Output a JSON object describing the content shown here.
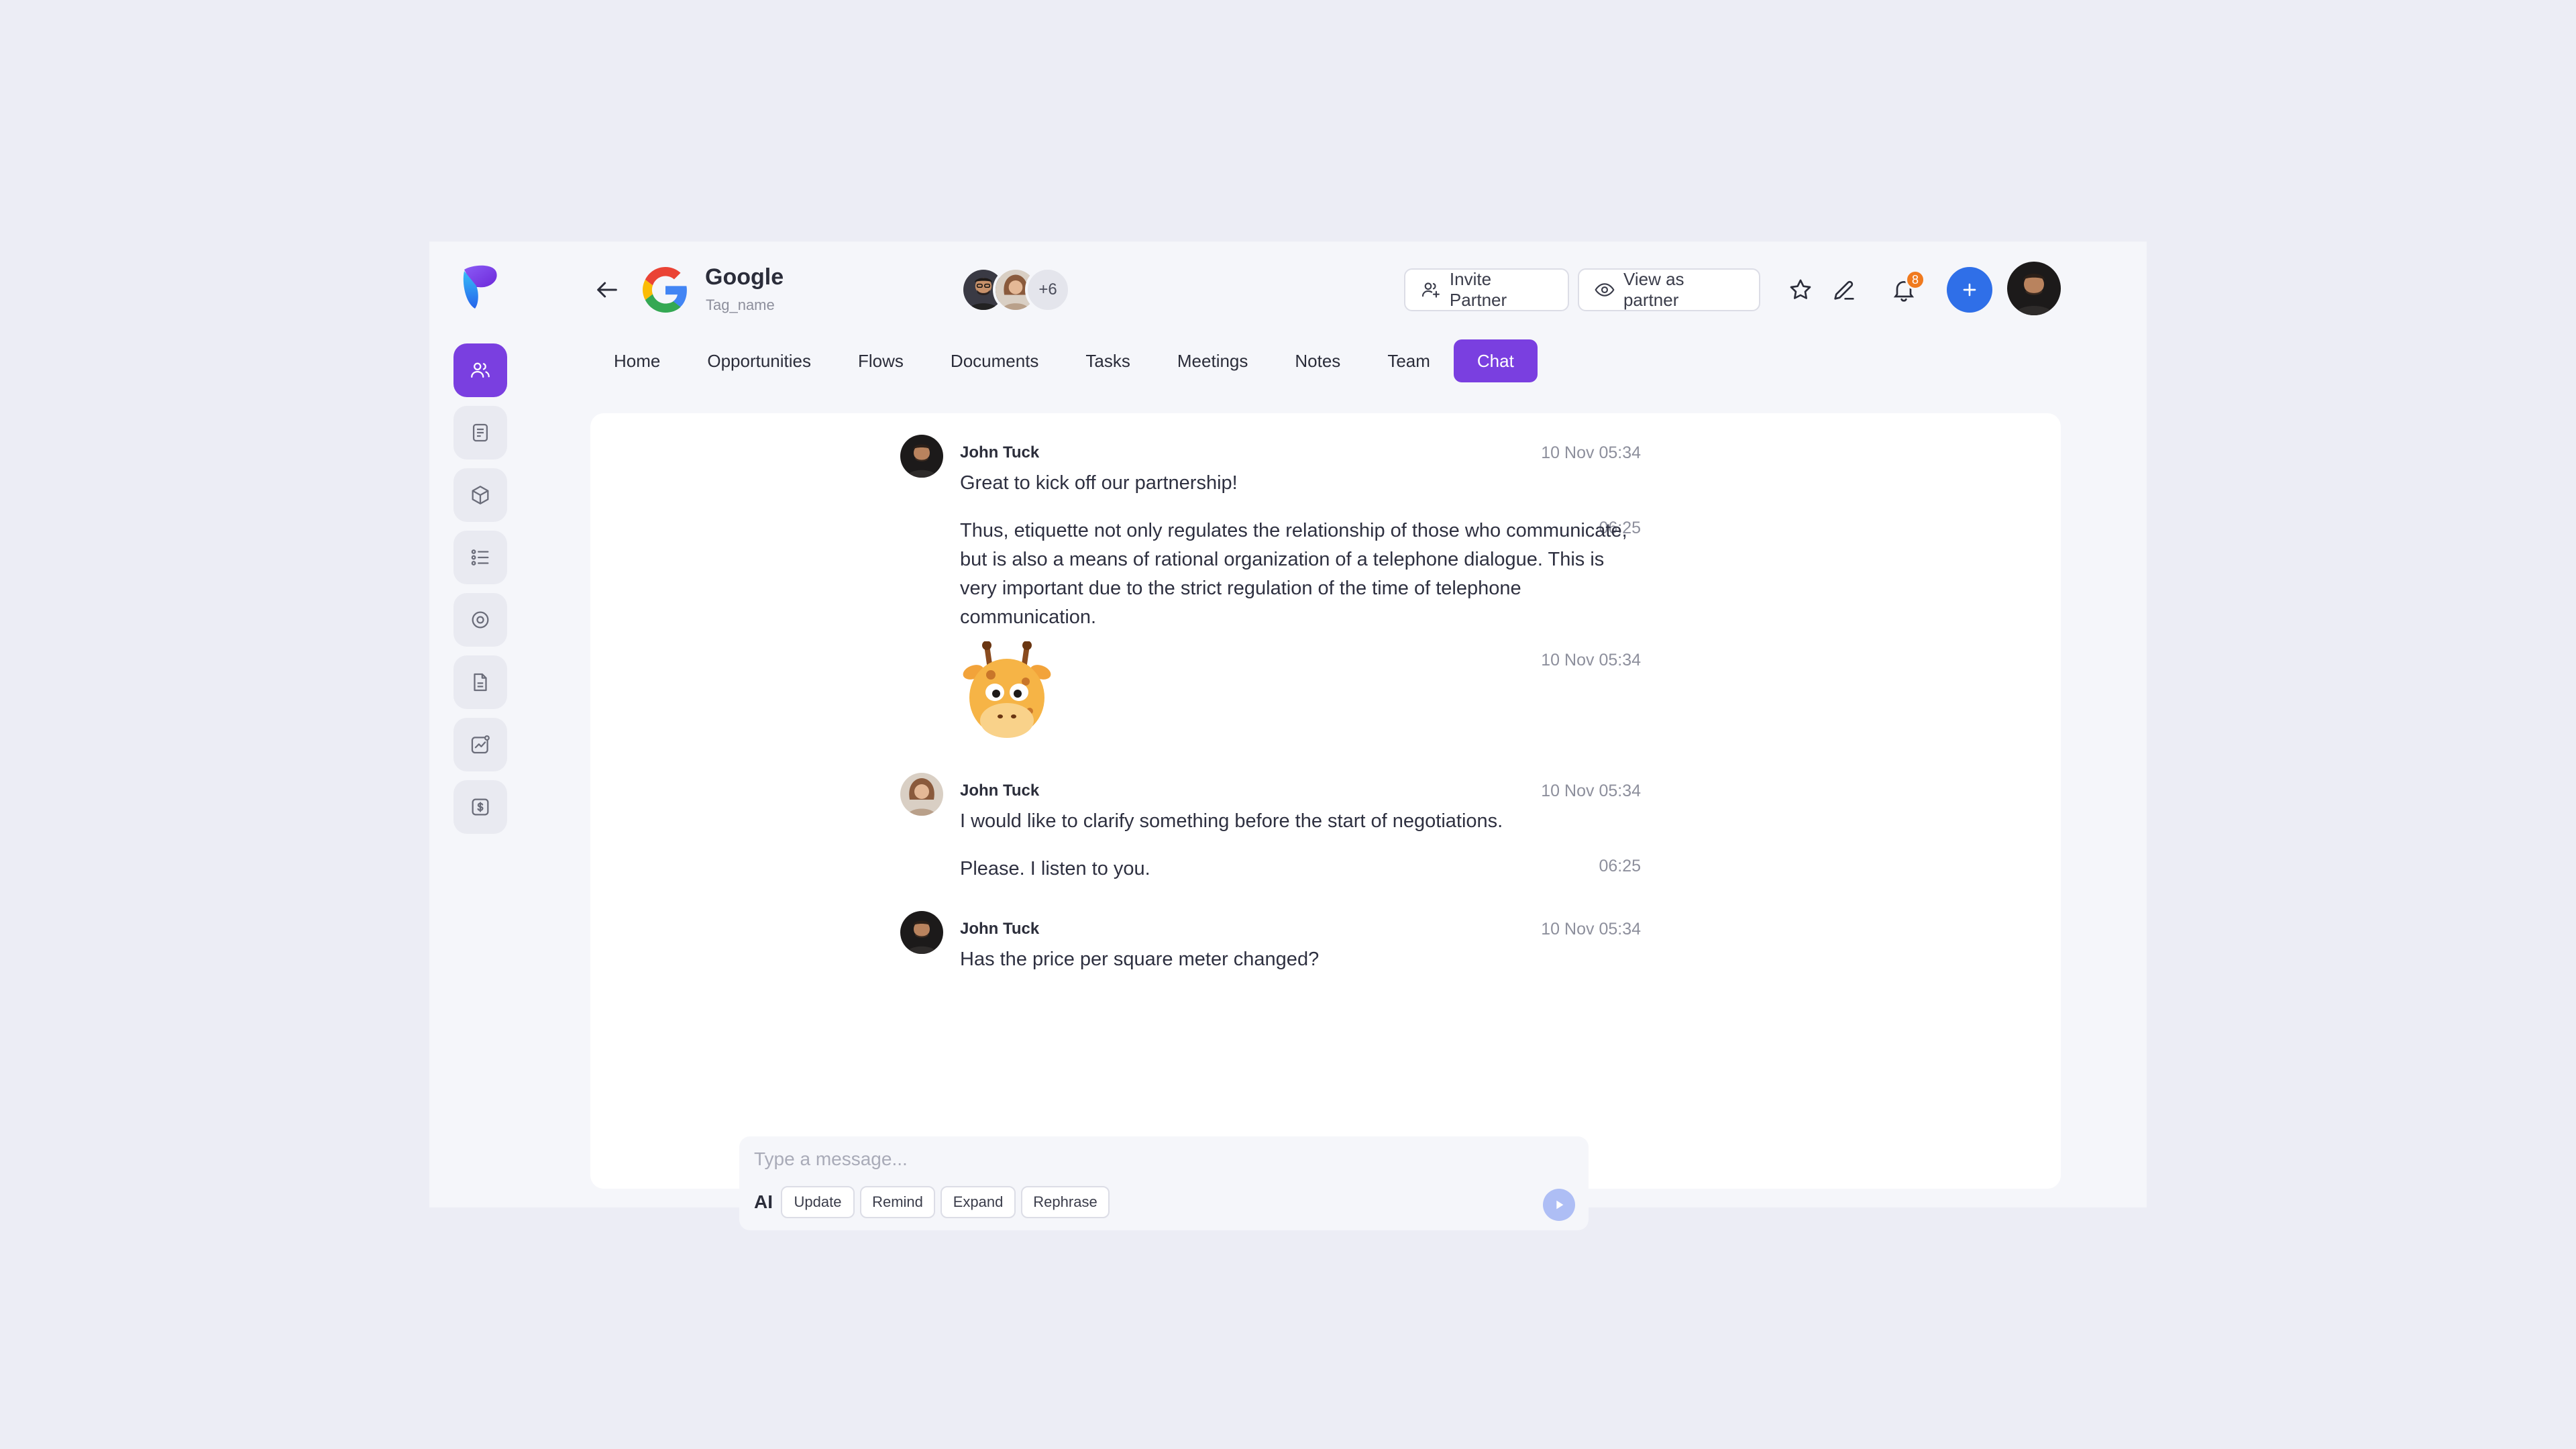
{
  "company": {
    "name": "Google",
    "tag": "Tag_name"
  },
  "participants": {
    "more": "+6"
  },
  "header": {
    "invite_label": "Invite Partner",
    "view_label": "View as partner",
    "notifications_count": "8"
  },
  "tabs": [
    {
      "label": "Home"
    },
    {
      "label": "Opportunities"
    },
    {
      "label": "Flows"
    },
    {
      "label": "Documents"
    },
    {
      "label": "Tasks"
    },
    {
      "label": "Meetings"
    },
    {
      "label": "Notes"
    },
    {
      "label": "Team"
    },
    {
      "label": "Chat",
      "active": true
    }
  ],
  "messages": [
    {
      "sender": "John Tuck",
      "text": "Great to kick off our partnership!",
      "time": "10 Nov 05:34"
    },
    {
      "text": "Thus, etiquette not only regulates the relationship of those who communicate, but is also a means of rational organization of a telephone dialogue. This is very important due to the strict regulation of the time of telephone communication.",
      "time": "06:25"
    },
    {
      "sticker": "giraffe-sticker",
      "time": "10 Nov 05:34"
    },
    {
      "sender": "John Tuck",
      "text": "I would like to clarify something before the start of negotiations.",
      "time": "10 Nov 05:34"
    },
    {
      "text": "Please. I listen to you.",
      "time": "06:25"
    },
    {
      "sender": "John Tuck",
      "text": "Has the price per square meter changed?",
      "time": "10 Nov 05:34"
    }
  ],
  "composer": {
    "placeholder": "Type a message...",
    "ai_label": "AI",
    "chips": [
      "Update",
      "Remind",
      "Expand",
      "Rephrase"
    ]
  },
  "colors": {
    "accent": "#7A3FE0",
    "primary_blue": "#2F6FE8",
    "badge_orange": "#F07A1E",
    "background": "#ECEDF5"
  }
}
